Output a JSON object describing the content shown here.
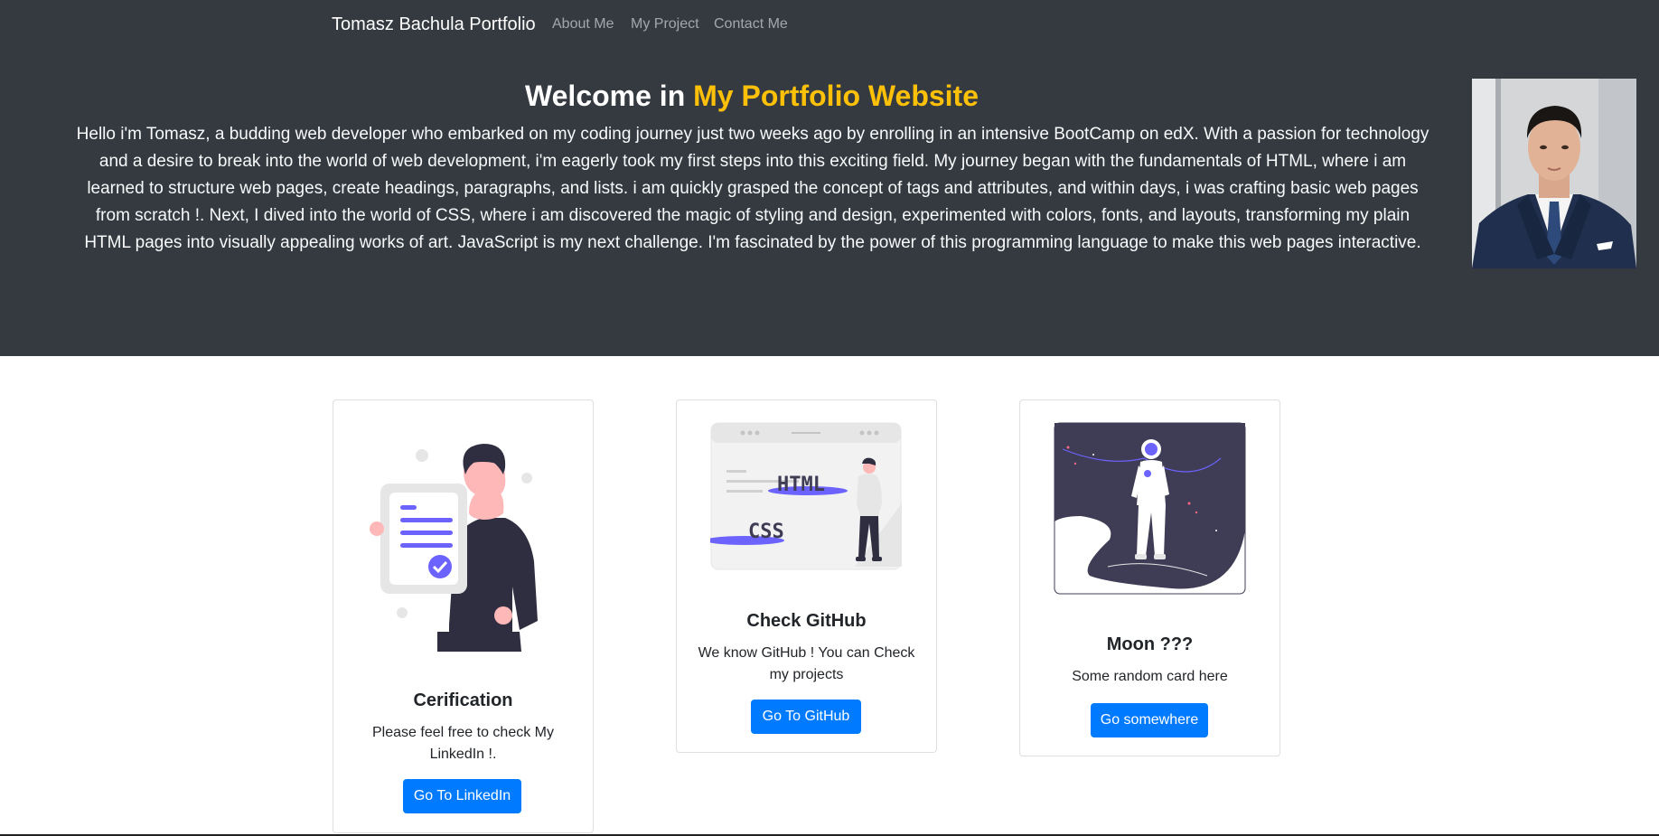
{
  "navbar": {
    "brand": "Tomasz Bachula Portfolio",
    "links": [
      "About Me",
      "My Project",
      "Contact Me"
    ]
  },
  "hero": {
    "title_prefix": "Welcome in ",
    "title_accent": "My Portfolio Website",
    "text": "Hello i'm Tomasz, a budding web developer who embarked on my coding journey just two weeks ago by enrolling in an intensive BootCamp on edX. With a passion for technology and a desire to break into the world of web development, i'm eagerly took my first steps into this exciting field. My journey began with the fundamentals of HTML, where i am learned to structure web pages, create headings, paragraphs, and lists. i am quickly grasped the concept of tags and attributes, and within days, i was crafting basic web pages from scratch !. Next, I dived into the world of CSS, where i am discovered the magic of styling and design, experimented with colors, fonts, and layouts, transforming my plain HTML pages into visually appealing works of art. JavaScript is my next challenge. I'm fascinated by the power of this programming language to make this web pages interactive."
  },
  "cards": [
    {
      "title": "Cerification",
      "text": "Please feel free to check My LinkedIn !.",
      "button": "Go To LinkedIn",
      "illustration": "certificate-illustration"
    },
    {
      "title": "Check GitHub",
      "text": "We know GitHub ! You can Check my projects",
      "button": "Go To GitHub",
      "illustration": "html-css-illustration",
      "labels": [
        "HTML",
        "CSS"
      ]
    },
    {
      "title": "Moon ???",
      "text": "Some random card here",
      "button": "Go somewhere",
      "illustration": "astronaut-illustration"
    }
  ],
  "colors": {
    "hero_bg": "#343a40",
    "accent": "#ffc107",
    "primary": "#007bff",
    "illustration_purple": "#6c63ff"
  }
}
